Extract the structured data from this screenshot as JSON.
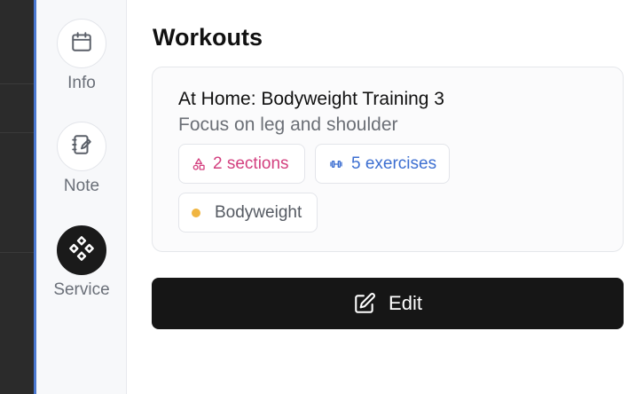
{
  "rail": {
    "items": [
      {
        "label": "Info",
        "icon": "calendar-icon",
        "active": false
      },
      {
        "label": "Note",
        "icon": "notebook-edit-icon",
        "active": false
      },
      {
        "label": "Service",
        "icon": "diamond-grid-icon",
        "active": true
      }
    ]
  },
  "main": {
    "title": "Workouts",
    "workout": {
      "title": "At Home: Bodyweight Training 3",
      "subtitle": "Focus on leg and shoulder",
      "sections_label": "2 sections",
      "exercises_label": "5 exercises",
      "type_label": "Bodyweight"
    },
    "edit_label": "Edit"
  },
  "colors": {
    "sections": "#d3407f",
    "exercises": "#3d6fd1",
    "type_dot": "#f0b541",
    "accent_line": "#4a78d0",
    "button_bg": "#161616"
  }
}
